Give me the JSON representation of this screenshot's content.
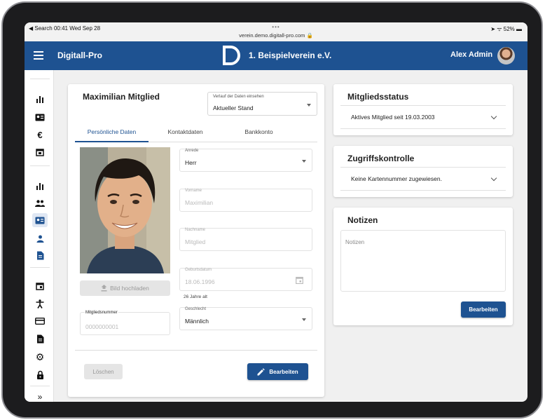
{
  "statusbar": {
    "left": "◀ Search  00:41  Wed Sep 28",
    "dots": "•••",
    "url": "verein.demo.digitall-pro.com 🔒",
    "right": "➤ ᯤ 52% ▬"
  },
  "appbar": {
    "title": "Digitall-Pro",
    "club_name": "1. Beispielverein e.V.",
    "user_name": "Alex Admin"
  },
  "sidebar": {
    "items": [
      {
        "name": "sidebar-item-stats",
        "icon": "bar-chart-icon",
        "glyph": "▮"
      },
      {
        "name": "sidebar-item-id-card",
        "icon": "id-card-icon",
        "glyph": "▤"
      },
      {
        "name": "sidebar-item-finance",
        "icon": "euro-icon",
        "glyph": "€"
      },
      {
        "name": "sidebar-item-calendar",
        "icon": "calendar-icon",
        "glyph": "▣"
      },
      {
        "name": "sidebar-item-member-stats",
        "icon": "bar-chart-icon",
        "glyph": "▮"
      },
      {
        "name": "sidebar-item-groups",
        "icon": "people-icon",
        "glyph": "👥"
      },
      {
        "name": "sidebar-item-members",
        "icon": "member-card-icon",
        "glyph": "▤"
      },
      {
        "name": "sidebar-item-person",
        "icon": "person-icon",
        "glyph": "●"
      },
      {
        "name": "sidebar-item-documents",
        "icon": "document-icon",
        "glyph": "▤"
      },
      {
        "name": "sidebar-item-events",
        "icon": "calendar-icon",
        "glyph": "▣"
      },
      {
        "name": "sidebar-item-sports",
        "icon": "accessibility-icon",
        "glyph": "✱"
      },
      {
        "name": "sidebar-item-payments",
        "icon": "credit-card-icon",
        "glyph": "▭"
      },
      {
        "name": "sidebar-item-files",
        "icon": "files-icon",
        "glyph": "▤"
      },
      {
        "name": "sidebar-item-settings",
        "icon": "gear-icon",
        "glyph": "⚙"
      },
      {
        "name": "sidebar-item-security",
        "icon": "lock-icon",
        "glyph": "🔒"
      },
      {
        "name": "sidebar-expand",
        "icon": "double-chevron-right-icon",
        "glyph": "»"
      }
    ]
  },
  "member": {
    "name": "Maximilian Mitglied",
    "history_select": {
      "label": "Verlauf der Daten einsehen",
      "value": "Aktueller Stand"
    },
    "tabs": [
      "Persönliche Daten",
      "Kontaktdaten",
      "Bankkonto"
    ],
    "upload_label": "Bild hochladen",
    "fields": {
      "anrede": {
        "label": "Anrede",
        "value": "Herr"
      },
      "vorname": {
        "label": "Vorname",
        "value": "Maximilian"
      },
      "nachname": {
        "label": "Nachname",
        "value": "Mitglied"
      },
      "geburtsdatum": {
        "label": "Geburtsdatum",
        "value": "18.06.1996"
      },
      "age_hint": "26 Jahre alt",
      "geschlecht": {
        "label": "Geschlecht",
        "value": "Männlich"
      },
      "mitgliedsnummer": {
        "label": "Mitgliedsnummer",
        "value": "0000000001"
      }
    },
    "delete_label": "Löschen",
    "edit_label": "Bearbeiten"
  },
  "status_card": {
    "title": "Mitgliedsstatus",
    "value": "Aktives Mitglied seit 19.03.2003"
  },
  "access_card": {
    "title": "Zugriffskontrolle",
    "value": "Keine Kartennummer zugewiesen."
  },
  "notes_card": {
    "title": "Notizen",
    "placeholder": "Notizen",
    "edit_label": "Bearbeiten"
  },
  "colors": {
    "primary": "#1e5291",
    "background": "#f0f0f0"
  }
}
